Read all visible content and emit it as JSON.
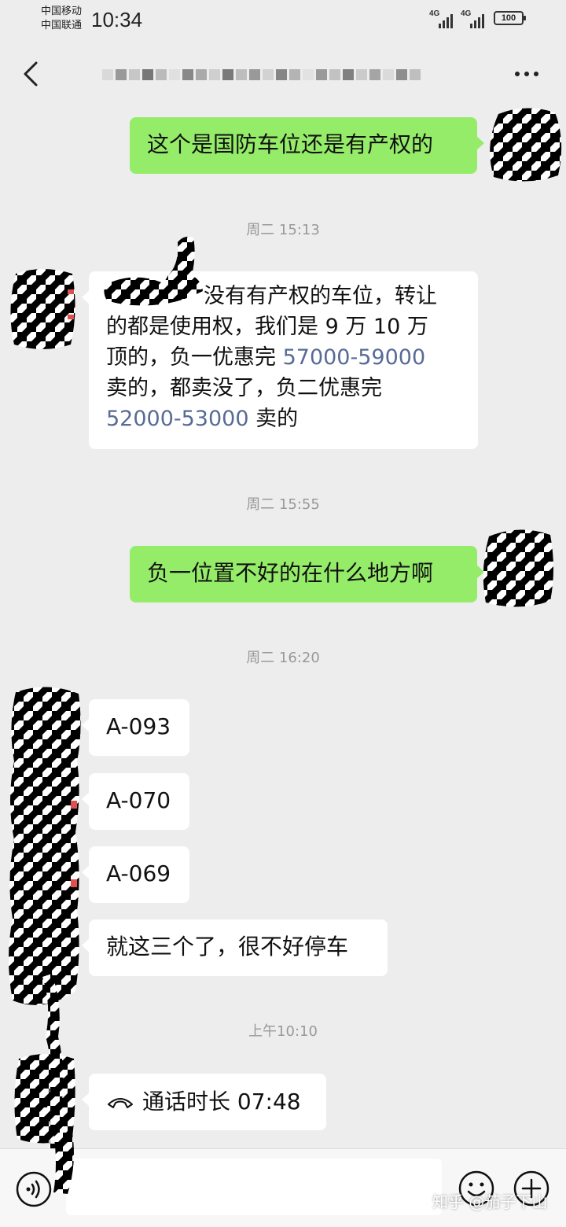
{
  "status_bar": {
    "carrier_1": "中国移动",
    "carrier_2": "中国联通",
    "time": "10:34",
    "signal_1": "4G",
    "signal_2": "4G",
    "battery": "100"
  },
  "header": {
    "title": "",
    "back_icon": "chevron-left-icon",
    "more_icon": "more-horizontal-icon"
  },
  "messages": [
    {
      "type": "outgoing",
      "text": "这个是国防车位还是有产权的"
    },
    {
      "type": "timestamp",
      "text": "周二 15:13"
    },
    {
      "type": "incoming",
      "segments": [
        "没有有产权的车位，转让",
        "的都是使用权，我们是 9 万 10 万",
        "顶的，负一优惠完 ",
        "57000-59000",
        "卖的，都卖没了，负二优惠完",
        "52000-53000",
        " 卖的"
      ]
    },
    {
      "type": "timestamp",
      "text": "周二 15:55"
    },
    {
      "type": "outgoing",
      "text": "负一位置不好的在什么地方啊"
    },
    {
      "type": "timestamp",
      "text": "周二 16:20"
    },
    {
      "type": "incoming",
      "text": "A-093"
    },
    {
      "type": "incoming",
      "text": "A-070"
    },
    {
      "type": "incoming",
      "text": "A-069"
    },
    {
      "type": "incoming",
      "text": "就这三个了，很不好停车"
    },
    {
      "type": "timestamp",
      "text": "上午10:10"
    },
    {
      "type": "incoming-call",
      "icon": "phone-hangup-icon",
      "text": "通话时长 07:48"
    }
  ],
  "input_bar": {
    "voice_icon": "voice-icon",
    "placeholder": "",
    "emoji_icon": "emoji-icon",
    "plus_icon": "plus-icon"
  },
  "watermark": "知乎 @茄子下山",
  "colors": {
    "background": "#ededed",
    "outgoing_bubble": "#95ec69",
    "incoming_bubble": "#ffffff",
    "number_link": "#576b95",
    "timestamp": "#999999"
  }
}
